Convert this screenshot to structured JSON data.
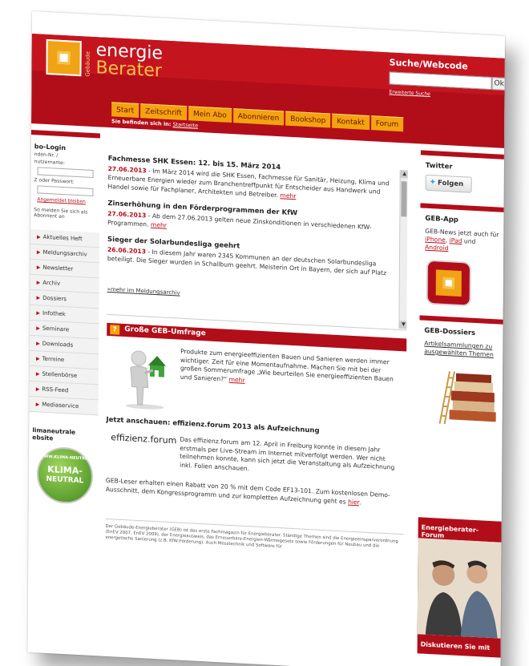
{
  "header": {
    "logo_vertical": "Gebäude",
    "logo_line1": "energie",
    "logo_line2": "Berater",
    "search_title": "Suche/Webcode",
    "search_button": "Ok",
    "search_advanced": "Erweiterte Suche"
  },
  "nav": {
    "items": [
      "Start",
      "Zeitschrift",
      "Mein Abo",
      "Abonnieren",
      "Bookshop",
      "Kontakt",
      "Forum"
    ]
  },
  "breadcrumb": {
    "label": "Sie befinden sich in:",
    "link": "Startseite"
  },
  "left": {
    "login_title": "bo-Login",
    "login_label1": "nden-Nr. /",
    "login_label1b": "nutzername:",
    "login_label2": "Z oder Passwort:",
    "login_link": "Angemeldet bleiben",
    "login_note": "So melden Sie sich als Abonnent an",
    "menu": [
      "Aktuelles Heft",
      "Meldungsarchiv",
      "Newsletter",
      "Archiv",
      "Dossiers",
      "Infothek",
      "Seminare",
      "Downloads",
      "Termine",
      "Stellenbörse",
      "RSS-Feed",
      "Mediaservice"
    ],
    "klima_title1": "limaneutrale",
    "klima_title2": "ebsite",
    "seal_top": "WWW.KLIMA-NEUTRAL",
    "seal_line1": "KLIMA-",
    "seal_line2": "NEUTRAL"
  },
  "news": [
    {
      "title": "Fachmesse SHK Essen: 12. bis 15. März 2014",
      "date": "27.06.2013",
      "text": " - Im März 2014 wird die SHK Essen, Fachmesse für Sanitär, Heizung, Klima und Erneuerbare Energien wieder zum Branchentreffpunkt für Entscheider aus Handwerk und Handel sowie für Fachplaner, Architekten und Betreiber. ",
      "more": "mehr"
    },
    {
      "title": "Zinserhöhung in den Förderprogrammen der KfW",
      "date": "27.06.2013",
      "text": " - Ab dem 27.06.2013 gelten neue Zinskonditionen in verschiedenen KfW-Programmen. ",
      "more": "mehr"
    },
    {
      "title": "Sieger der Solarbundesliga geehrt",
      "date": "26.06.2013",
      "text": " - In diesem Jahr waren 2345 Kommunen an der deutschen Solarbundesliga beteiligt. Die Sieger wurden in Schallbum geehrt. Meisterin Ort in Bayern, der sich auf Platz",
      "more": ""
    }
  ],
  "news_archive": "»mehr im Meldungsarchiv",
  "survey": {
    "icon": "?",
    "title": "Große GEB-Umfrage",
    "text": "Produkte zum energieeffizienten Bauen und Sanieren werden immer wichtiger. Zeit für eine Momentaufnahme. Machen Sie mit bei der großen Sommerumfrage „Wie beurteilen Sie energieeffizienten Bauen und Sanieren?“ ",
    "more": "mehr"
  },
  "effizienz": {
    "title": "Jetzt anschauen: effizienz.forum 2013 als Aufzeichnung",
    "logo_a": "effizienz",
    "logo_dot": ".",
    "logo_b": "forum",
    "text1": "Das effizienz.forum am 12. April in Freiburg konnte in diesem Jahr erstmals per Live-Stream im Internet mitverfolgt werden. Wer nicht teilnehmen konnte, kann sich jetzt die Veranstaltung als Aufzeichnung inkl. Folien anschauen.",
    "text2": "GEB-Leser erhalten einen Rabatt von 20 % mit dem Code EF13-101. Zum kostenlosen Demo-Ausschnitt, dem Kongressprogramm und zur kompletten Aufzeichnung geht es ",
    "here": "hier",
    "here_end": "."
  },
  "footer": "Der Gebäude-Energieberater (GEB) ist das erste Fachmagazin für Energieberater. Ständige Themen sind die Energieeinsparverordnung (EnEV 2007, EnEV 2009), der Energieausweis, das Erneuerbare-Energien-Wärmegesetz sowie Förderungen für Neubau und die energetische Sanierung (z.B. KfW-Förderung). Auch Messtechnik und Software für",
  "right": {
    "twitter_title": "Twitter",
    "follow": "Folgen",
    "app_title": "GEB-App",
    "app_text": "GEB-News jetzt auch für ",
    "app_iphone": "iPhone",
    "app_comma": ", ",
    "app_ipad": "iPad",
    "app_and": " und ",
    "app_android": "Android",
    "dossiers_title": "GEB-Dossiers",
    "dossiers_link": "Artikelsammlungen zu ausgewählten Themen",
    "forum_title": "Energieberater-Forum",
    "forum_cta": "Diskutieren Sie mit"
  },
  "colors": {
    "brand_red": "#b20e1a",
    "accent_orange": "#f3a30f"
  }
}
